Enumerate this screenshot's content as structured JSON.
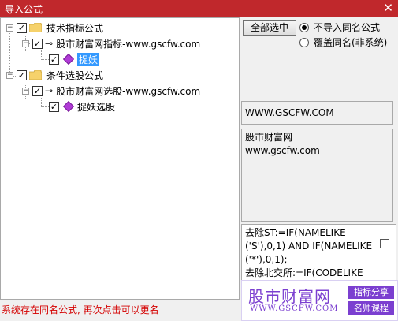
{
  "window": {
    "title": "导入公式",
    "close_glyph": "✕"
  },
  "tree": {
    "check_glyph": "✓",
    "collapse_glyph": "−",
    "nodes": [
      {
        "label": "技术指标公式",
        "icon": "folder-icon",
        "checked": true
      },
      {
        "label": "股市财富网指标-www.gscfw.com",
        "icon": "key-icon",
        "checked": true
      },
      {
        "label": "捉妖",
        "icon": "formula-icon",
        "checked": true,
        "selected": true
      },
      {
        "label": "条件选股公式",
        "icon": "folder-icon",
        "checked": true
      },
      {
        "label": "股市财富网选股-www.gscfw.com",
        "icon": "key-icon",
        "checked": true
      },
      {
        "label": "捉妖选股",
        "icon": "formula-icon",
        "checked": true
      }
    ]
  },
  "options": {
    "select_all_label": "全部选中",
    "radio_skip_label": "不导入同名公式",
    "radio_overwrite_label": "覆盖同名(非系统)",
    "selected": "skip"
  },
  "info": {
    "site": "WWW.GSCFW.COM",
    "description": "股市财富网\nwww.gscfw.com",
    "code": "去除ST:=IF(NAMELIKE\n('S'),0,1) AND IF(NAMELIKE\n('*'),0,1);\n去除北交所:=IF(CODELIKE"
  },
  "status": {
    "message": "系统存在同名公式, 再次点击可以更名"
  },
  "watermark": {
    "name_cn": "股市财富网",
    "url": "WWW.GSCFW.COM",
    "tag1": "指标分享",
    "tag2": "名师课程"
  },
  "colors": {
    "titlebar": "#c0282c",
    "status_text": "#d40000",
    "selection": "#3399ff",
    "brand_purple": "#7b3fd0"
  }
}
